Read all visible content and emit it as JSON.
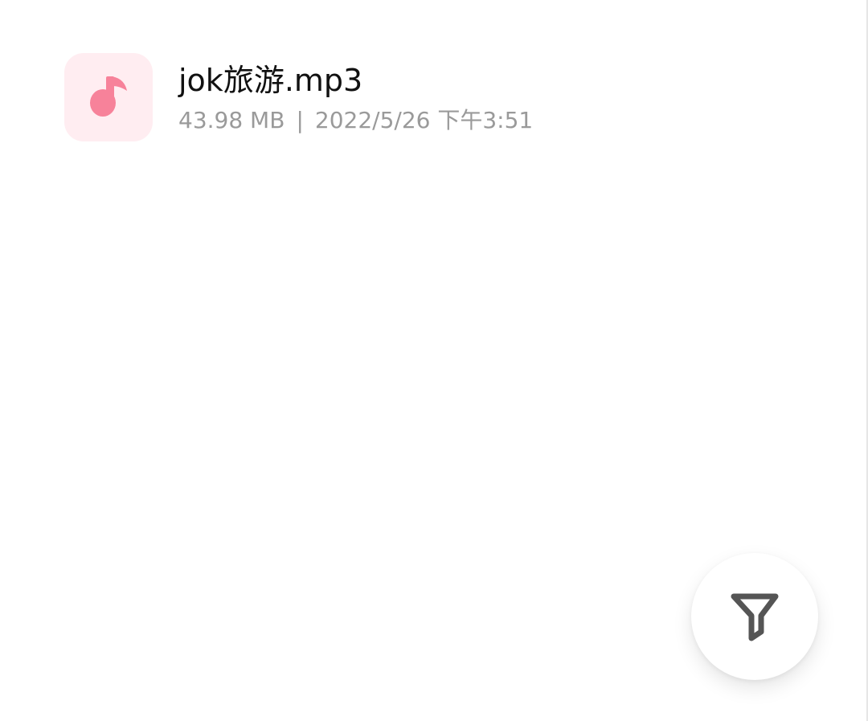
{
  "colors": {
    "icon_bg": "#ffedf1",
    "icon_fg": "#f7829a",
    "text_primary": "#111111",
    "text_secondary": "#9a9a9a",
    "fab_icon": "#555555"
  },
  "file": {
    "icon": "music-note-icon",
    "name": "jok旅游.mp3",
    "size": "43.98 MB",
    "separator": "|",
    "modified": "2022/5/26 下午3:51"
  },
  "fab": {
    "icon": "filter-icon"
  }
}
